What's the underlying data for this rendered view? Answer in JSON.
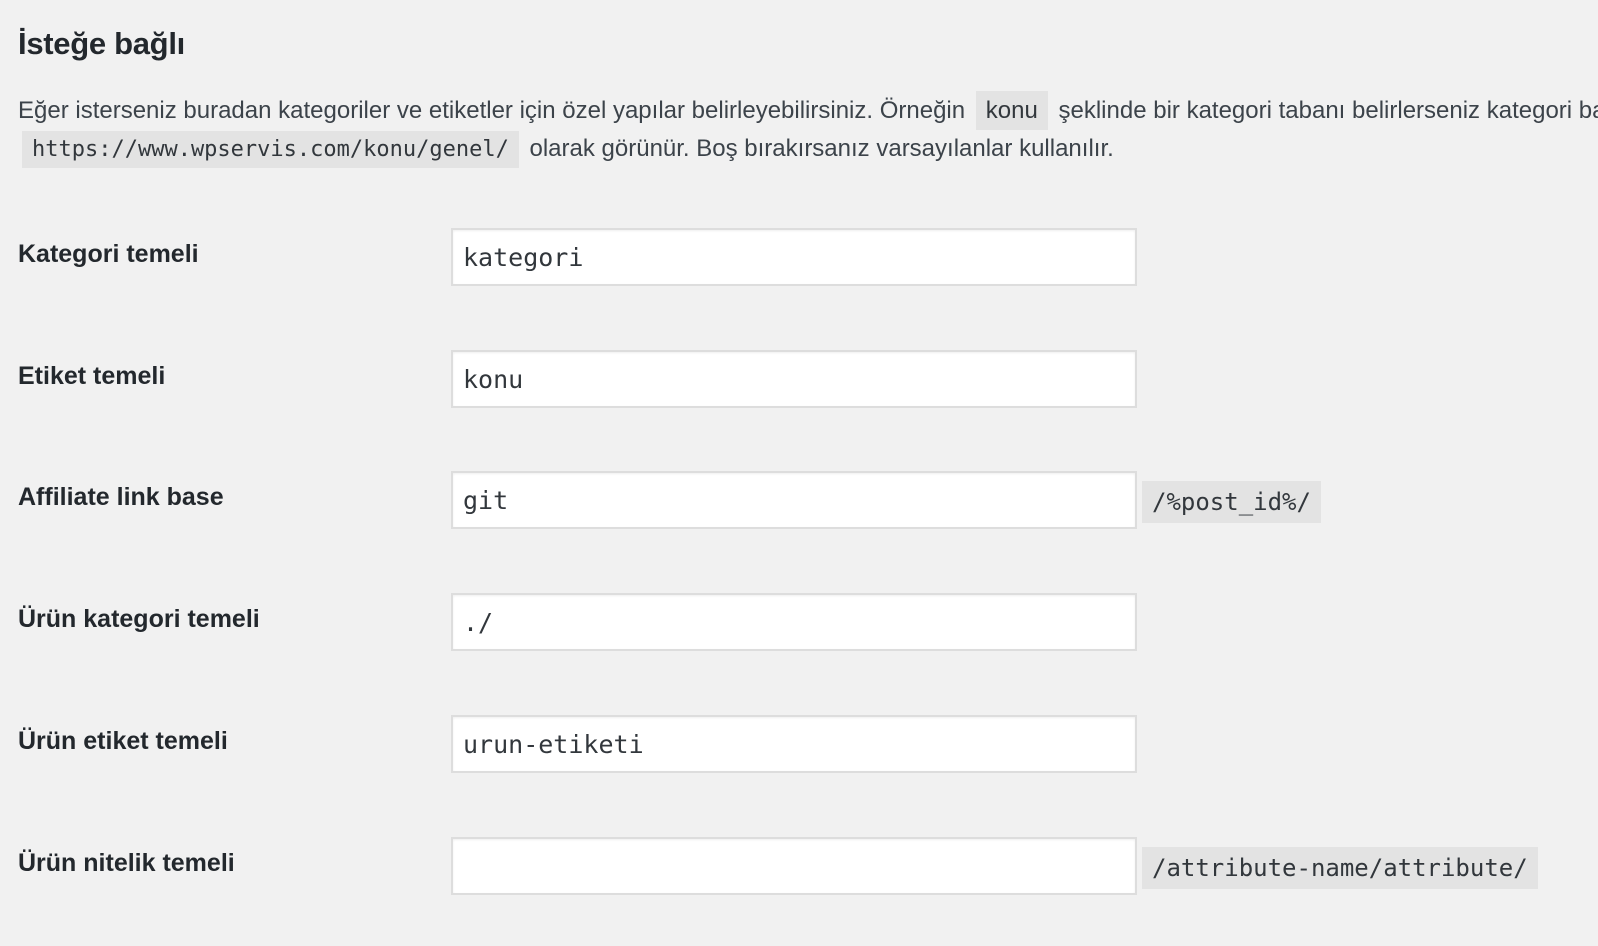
{
  "section": {
    "title": "İsteğe bağlı",
    "description": {
      "part1": "Eğer isterseniz buradan kategoriler ve etiketler için özel yapılar belirleyebilirsiniz. Örneğin",
      "code1": "konu",
      "part2": "şeklinde bir kategori tabanı belirlerseniz kategori bağlantılarınız",
      "code2": "https://www.wpservis.com/konu/genel/",
      "part3": "olarak görünür. Boş bırakırsanız varsayılanlar kullanılır."
    }
  },
  "fields": [
    {
      "label": "Kategori temeli",
      "value": "kategori",
      "suffix": ""
    },
    {
      "label": "Etiket temeli",
      "value": "konu",
      "suffix": ""
    },
    {
      "label": "Affiliate link base",
      "value": "git",
      "suffix": "/%post_id%/"
    },
    {
      "label": "Ürün kategori temeli",
      "value": "./",
      "suffix": ""
    },
    {
      "label": "Ürün etiket temeli",
      "value": "urun-etiketi",
      "suffix": ""
    },
    {
      "label": "Ürün nitelik temeli",
      "value": "",
      "suffix": "/attribute-name/attribute/"
    }
  ]
}
